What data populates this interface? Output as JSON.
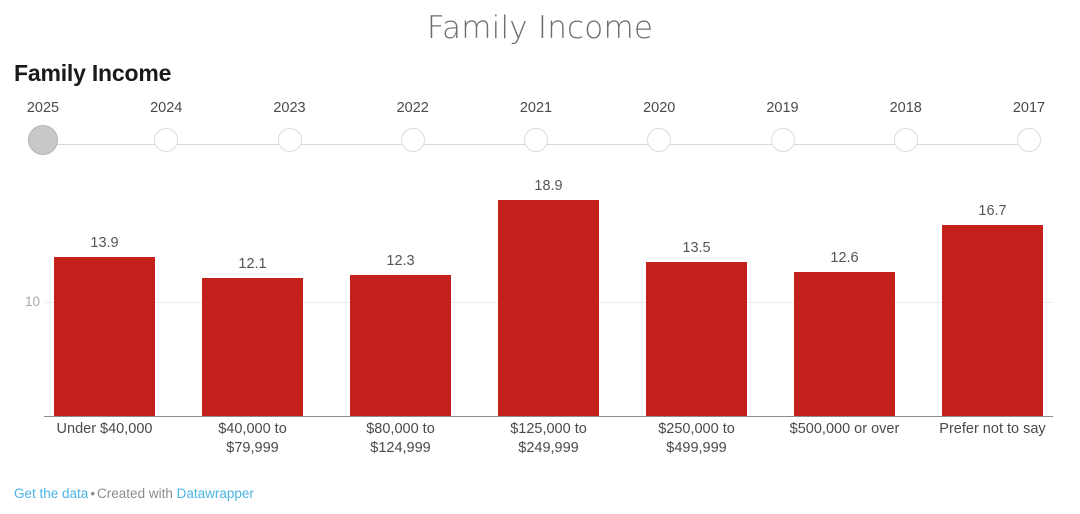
{
  "page": {
    "heading": "Family Income"
  },
  "chart": {
    "title": "Family Income"
  },
  "slider": {
    "years": [
      {
        "label": "2025",
        "selected": true
      },
      {
        "label": "2024",
        "selected": false
      },
      {
        "label": "2023",
        "selected": false
      },
      {
        "label": "2022",
        "selected": false
      },
      {
        "label": "2021",
        "selected": false
      },
      {
        "label": "2020",
        "selected": false
      },
      {
        "label": "2019",
        "selected": false
      },
      {
        "label": "2018",
        "selected": false
      },
      {
        "label": "2017",
        "selected": false
      }
    ]
  },
  "footer": {
    "get_data": "Get the data",
    "separator": "•",
    "created_with": "Created with",
    "brand": "Datawrapper"
  },
  "colors": {
    "bar": "#c4201c",
    "link": "#4ab4e6",
    "gridline": "#ececec",
    "axis": "#8d8d8d",
    "slider_selected": "#c9c9c9"
  },
  "chart_data": {
    "type": "bar",
    "title": "Family Income",
    "xlabel": "",
    "ylabel": "",
    "ylim": [
      0,
      21.5
    ],
    "grid": true,
    "gridlines": [
      10
    ],
    "ytick_labels": [
      "10"
    ],
    "legend": "none",
    "categories": [
      "Under $40,000",
      "$40,000 to $79,999",
      "$80,000 to $124,999",
      "$125,000 to $249,999",
      "$250,000 to $499,999",
      "$500,000 or over",
      "Prefer not to say"
    ],
    "category_lines": [
      [
        "Under $40,000"
      ],
      [
        "$40,000 to",
        "$79,999"
      ],
      [
        "$80,000 to",
        "$124,999"
      ],
      [
        "$125,000 to",
        "$249,999"
      ],
      [
        "$250,000 to",
        "$499,999"
      ],
      [
        "$500,000 or over"
      ],
      [
        "Prefer not to say"
      ]
    ],
    "values": [
      13.9,
      12.1,
      12.3,
      18.9,
      13.5,
      12.6,
      16.7
    ],
    "value_labels": [
      "13.9",
      "12.1",
      "12.3",
      "18.9",
      "13.5",
      "12.6",
      "16.7"
    ]
  }
}
